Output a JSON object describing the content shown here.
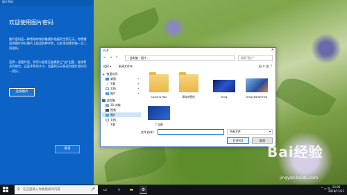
{
  "settings_panel": {
    "window_title": "图片密码",
    "heading": "欢迎使用图片密码",
    "paragraph1": "图片密码是一种帮助你保护触摸屏电脑的全新方法。你需要选择图片并在图片上画出各种手势，以此来创建你独一无二的密码。",
    "paragraph2": "选择一张图片后，你可以直接在触摸屏上\"画\"出圆、直线和点的组合。这些手势的大小、位置和方向将成为图片密码的一部分。",
    "choose_button": "选择图片",
    "cancel_button": "取消"
  },
  "open_dialog": {
    "title": "打开",
    "close_glyph": "✕",
    "breadcrumb": "› 此电脑 › 图片 ›",
    "search_placeholder": "搜索\"图片\"",
    "toolbar": {
      "organize": "组织 ▾",
      "new_folder": "新建文件夹"
    },
    "sidebar": [
      {
        "label": "快速访问",
        "icon": "star-icon"
      },
      {
        "label": "桌面",
        "icon": "desktop-icon"
      },
      {
        "label": "下载",
        "icon": "download-icon"
      },
      {
        "label": "文档",
        "icon": "document-icon"
      },
      {
        "label": "图片",
        "icon": "picture-icon"
      },
      {
        "label": "此电脑",
        "icon": "computer-icon"
      },
      {
        "label": "3D 对象",
        "icon": "cube-icon"
      },
      {
        "label": "视频",
        "icon": "video-icon"
      },
      {
        "label": "图片",
        "icon": "picture-icon"
      },
      {
        "label": "文档",
        "icon": "document-icon"
      },
      {
        "label": "下载",
        "icon": "download-icon"
      }
    ],
    "files": [
      {
        "name": "Camera Roll",
        "kind": "folder"
      },
      {
        "name": "保存的图片",
        "kind": "folder"
      },
      {
        "name": "timg",
        "kind": "image"
      },
      {
        "name": "timg(3DLW1HGI",
        "kind": "image"
      },
      {
        "name": "广告牌",
        "kind": "image"
      }
    ],
    "filename_label": "文件名(N):",
    "filename_value": "",
    "filetype_value": "所有文件",
    "open_button": "打开(O)",
    "cancel_button": "取消"
  },
  "watermark": {
    "logo": "Bai经验",
    "url": "jingyan.baidu.com"
  },
  "taskbar": {
    "search_placeholder": "在这里输入你要搜索的内容",
    "time": "13:06",
    "date": "2018/11/22",
    "tray_text": "^ ▭ 中"
  }
}
